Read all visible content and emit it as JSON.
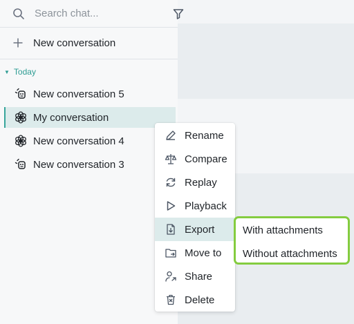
{
  "search": {
    "placeholder": "Search chat..."
  },
  "sidebar": {
    "new_conversation_label": "New conversation",
    "group_label": "Today",
    "conversations": [
      {
        "label": "New conversation 5",
        "icon": "bot-icon"
      },
      {
        "label": "My conversation",
        "icon": "openai-icon",
        "active": true
      },
      {
        "label": "New conversation 4",
        "icon": "openai-icon"
      },
      {
        "label": "New conversation 3",
        "icon": "bot-icon"
      }
    ]
  },
  "context_menu": {
    "items": [
      {
        "label": "Rename",
        "icon": "pencil-icon"
      },
      {
        "label": "Compare",
        "icon": "scale-icon"
      },
      {
        "label": "Replay",
        "icon": "replay-icon"
      },
      {
        "label": "Playback",
        "icon": "play-icon"
      },
      {
        "label": "Export",
        "icon": "export-file-icon",
        "active": true
      },
      {
        "label": "Move to",
        "icon": "folder-move-icon"
      },
      {
        "label": "Share",
        "icon": "share-user-icon"
      },
      {
        "label": "Delete",
        "icon": "trash-icon"
      }
    ]
  },
  "export_submenu": {
    "items": [
      {
        "label": "With attachments"
      },
      {
        "label": "Without attachments"
      }
    ]
  },
  "colors": {
    "accent": "#2d9c93",
    "active_bg": "#dcebeb",
    "highlight_border": "#84cc3f"
  }
}
